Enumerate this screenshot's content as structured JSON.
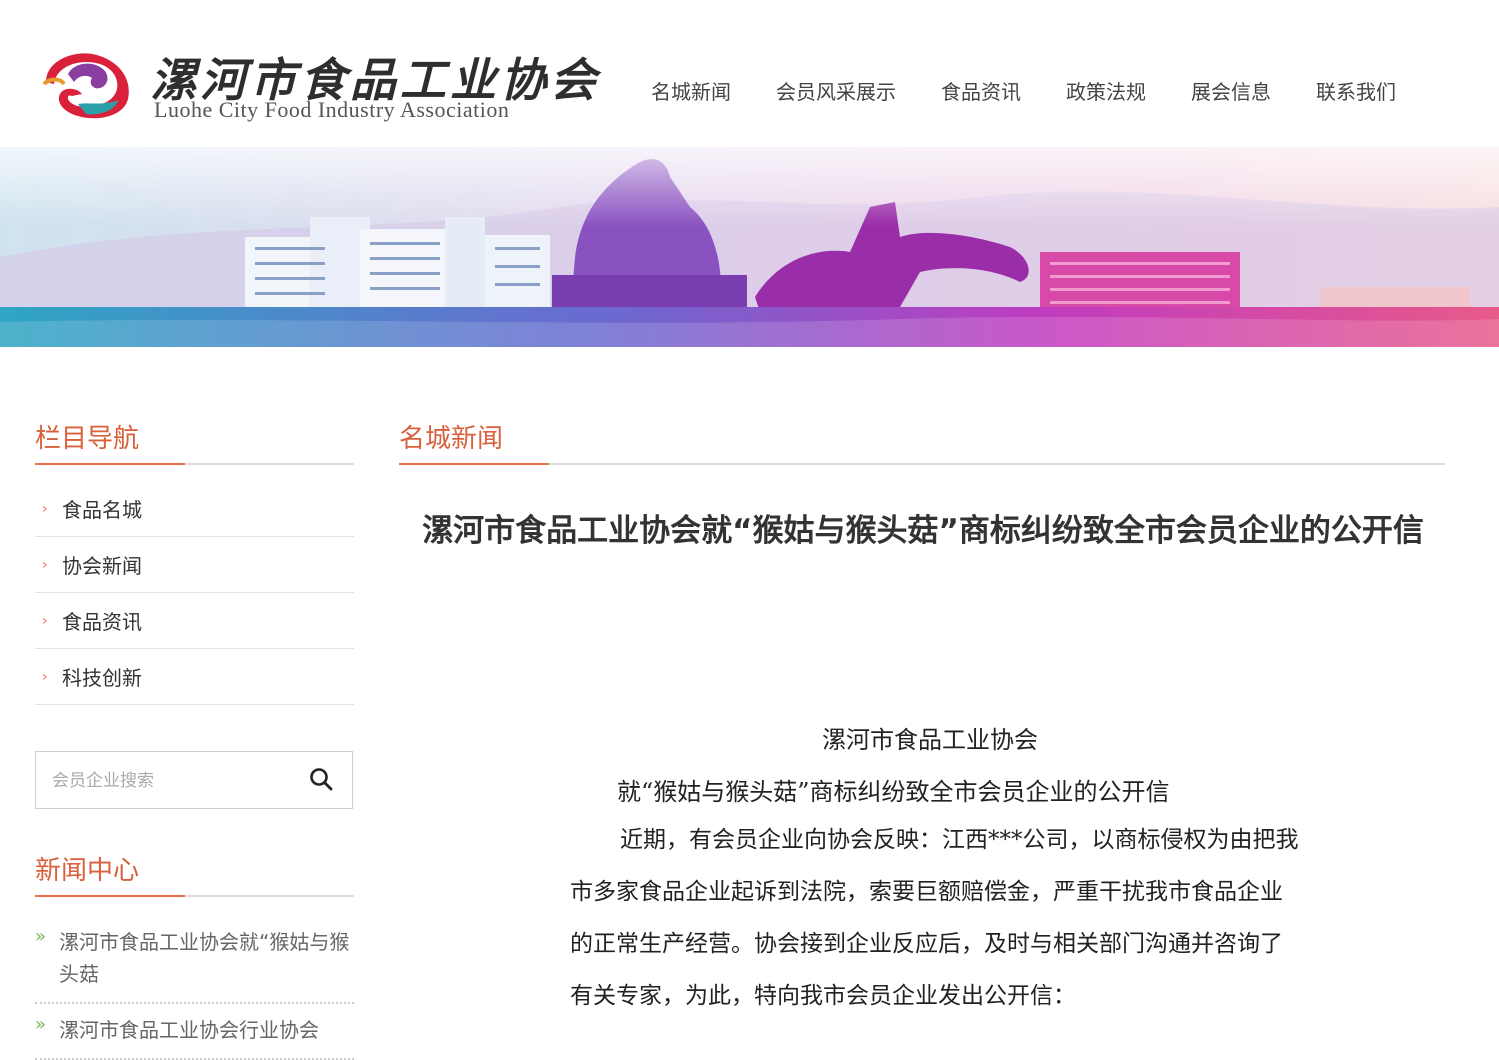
{
  "site": {
    "name_cn": "漯河市食品工业协会",
    "name_en": "Luohe City Food Industry Association"
  },
  "nav": [
    "名城新闻",
    "会员风采展示",
    "食品资讯",
    "政策法规",
    "展会信息",
    "联系我们"
  ],
  "sidebar": {
    "nav_title": "栏目导航",
    "menu": [
      "食品名城",
      "协会新闻",
      "食品资讯",
      "科技创新"
    ],
    "search_placeholder": "会员企业搜索",
    "news_title": "新闻中心",
    "news_items": [
      "漯河市食品工业协会就“猴姑与猴头菇",
      "漯河市食品工业协会行业协会"
    ]
  },
  "main": {
    "section_title": "名城新闻",
    "article_title": "漯河市食品工业协会就“猴姑与猴头菇”商标纠纷致全市会员企业的公开信",
    "doc": {
      "heading1": "漯河市食品工业协会",
      "heading2": "就“猴姑与猴头菇”商标纠纷致全市会员企业的公开信",
      "paragraph": "近期，有会员企业向协会反映：江西***公司，以商标侵权为由把我市多家食品企业起诉到法院，索要巨额赔偿金，严重干扰我市食品企业的正常生产经营。协会接到企业反应后，及时与相关部门沟通并咨询了有关专家，为此，特向我市会员企业发出公开信："
    }
  },
  "colors": {
    "accent": "#e8704e",
    "accent_text": "#d9603c",
    "bullet": "#7bb35a"
  }
}
